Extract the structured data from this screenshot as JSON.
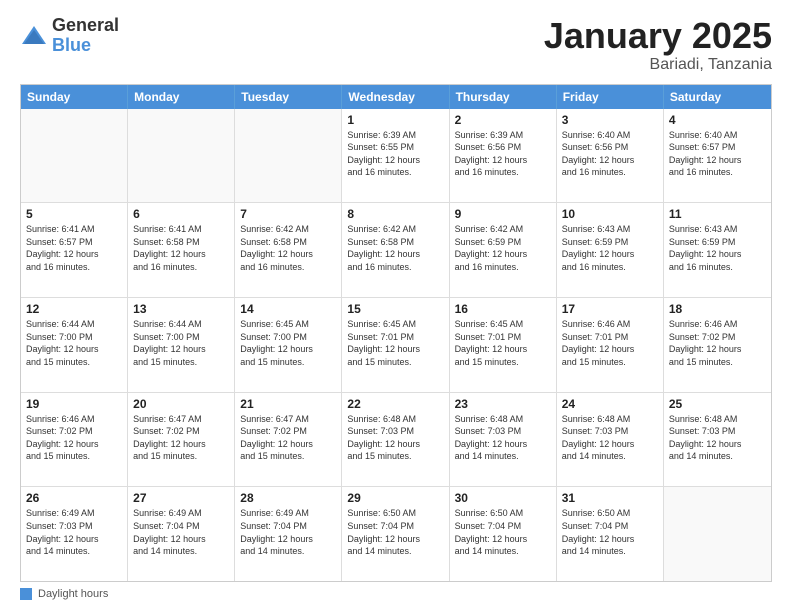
{
  "logo": {
    "general": "General",
    "blue": "Blue"
  },
  "title": "January 2025",
  "location": "Bariadi, Tanzania",
  "header_days": [
    "Sunday",
    "Monday",
    "Tuesday",
    "Wednesday",
    "Thursday",
    "Friday",
    "Saturday"
  ],
  "weeks": [
    [
      {
        "day": "",
        "text": ""
      },
      {
        "day": "",
        "text": ""
      },
      {
        "day": "",
        "text": ""
      },
      {
        "day": "1",
        "text": "Sunrise: 6:39 AM\nSunset: 6:55 PM\nDaylight: 12 hours\nand 16 minutes."
      },
      {
        "day": "2",
        "text": "Sunrise: 6:39 AM\nSunset: 6:56 PM\nDaylight: 12 hours\nand 16 minutes."
      },
      {
        "day": "3",
        "text": "Sunrise: 6:40 AM\nSunset: 6:56 PM\nDaylight: 12 hours\nand 16 minutes."
      },
      {
        "day": "4",
        "text": "Sunrise: 6:40 AM\nSunset: 6:57 PM\nDaylight: 12 hours\nand 16 minutes."
      }
    ],
    [
      {
        "day": "5",
        "text": "Sunrise: 6:41 AM\nSunset: 6:57 PM\nDaylight: 12 hours\nand 16 minutes."
      },
      {
        "day": "6",
        "text": "Sunrise: 6:41 AM\nSunset: 6:58 PM\nDaylight: 12 hours\nand 16 minutes."
      },
      {
        "day": "7",
        "text": "Sunrise: 6:42 AM\nSunset: 6:58 PM\nDaylight: 12 hours\nand 16 minutes."
      },
      {
        "day": "8",
        "text": "Sunrise: 6:42 AM\nSunset: 6:58 PM\nDaylight: 12 hours\nand 16 minutes."
      },
      {
        "day": "9",
        "text": "Sunrise: 6:42 AM\nSunset: 6:59 PM\nDaylight: 12 hours\nand 16 minutes."
      },
      {
        "day": "10",
        "text": "Sunrise: 6:43 AM\nSunset: 6:59 PM\nDaylight: 12 hours\nand 16 minutes."
      },
      {
        "day": "11",
        "text": "Sunrise: 6:43 AM\nSunset: 6:59 PM\nDaylight: 12 hours\nand 16 minutes."
      }
    ],
    [
      {
        "day": "12",
        "text": "Sunrise: 6:44 AM\nSunset: 7:00 PM\nDaylight: 12 hours\nand 15 minutes."
      },
      {
        "day": "13",
        "text": "Sunrise: 6:44 AM\nSunset: 7:00 PM\nDaylight: 12 hours\nand 15 minutes."
      },
      {
        "day": "14",
        "text": "Sunrise: 6:45 AM\nSunset: 7:00 PM\nDaylight: 12 hours\nand 15 minutes."
      },
      {
        "day": "15",
        "text": "Sunrise: 6:45 AM\nSunset: 7:01 PM\nDaylight: 12 hours\nand 15 minutes."
      },
      {
        "day": "16",
        "text": "Sunrise: 6:45 AM\nSunset: 7:01 PM\nDaylight: 12 hours\nand 15 minutes."
      },
      {
        "day": "17",
        "text": "Sunrise: 6:46 AM\nSunset: 7:01 PM\nDaylight: 12 hours\nand 15 minutes."
      },
      {
        "day": "18",
        "text": "Sunrise: 6:46 AM\nSunset: 7:02 PM\nDaylight: 12 hours\nand 15 minutes."
      }
    ],
    [
      {
        "day": "19",
        "text": "Sunrise: 6:46 AM\nSunset: 7:02 PM\nDaylight: 12 hours\nand 15 minutes."
      },
      {
        "day": "20",
        "text": "Sunrise: 6:47 AM\nSunset: 7:02 PM\nDaylight: 12 hours\nand 15 minutes."
      },
      {
        "day": "21",
        "text": "Sunrise: 6:47 AM\nSunset: 7:02 PM\nDaylight: 12 hours\nand 15 minutes."
      },
      {
        "day": "22",
        "text": "Sunrise: 6:48 AM\nSunset: 7:03 PM\nDaylight: 12 hours\nand 15 minutes."
      },
      {
        "day": "23",
        "text": "Sunrise: 6:48 AM\nSunset: 7:03 PM\nDaylight: 12 hours\nand 14 minutes."
      },
      {
        "day": "24",
        "text": "Sunrise: 6:48 AM\nSunset: 7:03 PM\nDaylight: 12 hours\nand 14 minutes."
      },
      {
        "day": "25",
        "text": "Sunrise: 6:48 AM\nSunset: 7:03 PM\nDaylight: 12 hours\nand 14 minutes."
      }
    ],
    [
      {
        "day": "26",
        "text": "Sunrise: 6:49 AM\nSunset: 7:03 PM\nDaylight: 12 hours\nand 14 minutes."
      },
      {
        "day": "27",
        "text": "Sunrise: 6:49 AM\nSunset: 7:04 PM\nDaylight: 12 hours\nand 14 minutes."
      },
      {
        "day": "28",
        "text": "Sunrise: 6:49 AM\nSunset: 7:04 PM\nDaylight: 12 hours\nand 14 minutes."
      },
      {
        "day": "29",
        "text": "Sunrise: 6:50 AM\nSunset: 7:04 PM\nDaylight: 12 hours\nand 14 minutes."
      },
      {
        "day": "30",
        "text": "Sunrise: 6:50 AM\nSunset: 7:04 PM\nDaylight: 12 hours\nand 14 minutes."
      },
      {
        "day": "31",
        "text": "Sunrise: 6:50 AM\nSunset: 7:04 PM\nDaylight: 12 hours\nand 14 minutes."
      },
      {
        "day": "",
        "text": ""
      }
    ]
  ],
  "footer": {
    "label": "Daylight hours"
  }
}
